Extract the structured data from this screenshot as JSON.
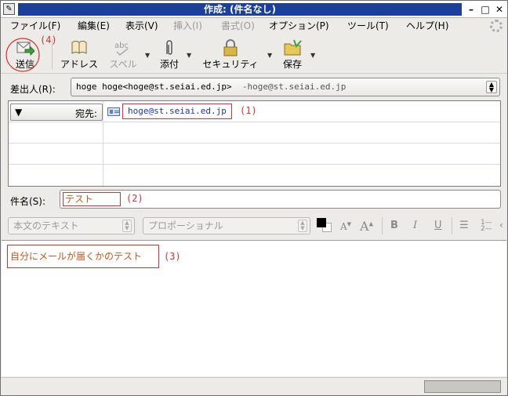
{
  "window": {
    "title": "作成: (件名なし)"
  },
  "menu": [
    "ファイル(F)",
    "編集(E)",
    "表示(V)",
    "挿入(I)",
    "書式(O)",
    "オプション(P)",
    "ツール(T)",
    "ヘルプ(H)"
  ],
  "menu_disabled": [
    "挿入(I)",
    "書式(O)"
  ],
  "toolbar": {
    "send": "送信",
    "address": "アドレス",
    "spell": "スペル",
    "attach": "添付",
    "security": "セキュリティ",
    "save": "保存"
  },
  "from": {
    "label": "差出人(R):",
    "value": "hoge hoge<hoge@st.seiai.ed.jp>",
    "secondary": "-hoge@st.seiai.ed.jp"
  },
  "recipients": [
    {
      "type": "宛先:",
      "address": "hoge@st.seiai.ed.jp"
    }
  ],
  "subject": {
    "label": "件名(S):",
    "value": "テスト"
  },
  "format": {
    "paragraph": "本文のテキスト",
    "font": "プロポーショナル"
  },
  "body": {
    "text": "自分にメールが届くかのテスト"
  },
  "annotations": {
    "a1": "(1)",
    "a2": "(2)",
    "a3": "(3)",
    "a4": "(4)"
  },
  "colors": {
    "titlebar": "#1c3f9a",
    "annotation": "#d23333",
    "link": "#1b33b5"
  }
}
